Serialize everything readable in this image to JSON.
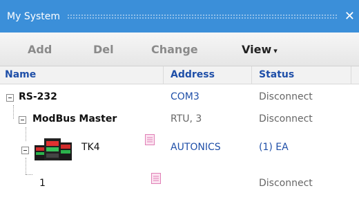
{
  "window": {
    "title": "My System",
    "close_glyph": "✕"
  },
  "toolbar": {
    "add": "Add",
    "del": "Del",
    "change": "Change",
    "view": "View",
    "view_caret": "▾"
  },
  "columns": {
    "name": "Name",
    "address": "Address",
    "status": "Status"
  },
  "tree": {
    "rs232": {
      "name": "RS-232",
      "address": "COM3",
      "status": "Disconnect"
    },
    "modbus": {
      "name": "ModBus Master",
      "address": "RTU, 3",
      "status": "Disconnect"
    },
    "tk4": {
      "name": "TK4",
      "address": "AUTONICS",
      "status": "(1) EA",
      "icon": "temperature-controller-device-icon"
    },
    "unit1": {
      "name": "1",
      "address": "",
      "status": "Disconnect"
    }
  },
  "colors": {
    "titlebar": "#3b8fd9",
    "header_text": "#1f4fa8",
    "address_link": "#1f4fa8",
    "doc_icon": "#e07fb6"
  }
}
